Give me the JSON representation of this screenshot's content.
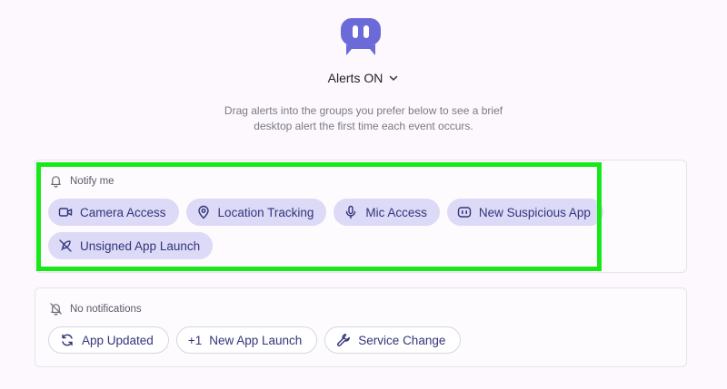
{
  "header": {
    "logo_icon": "robot-face-logo",
    "alerts_label": "Alerts ON",
    "description_line1": "Drag alerts into the groups you prefer below to see a brief",
    "description_line2": "desktop alert the first time each event occurs."
  },
  "groups": {
    "notify": {
      "title": "Notify me",
      "icon": "bell-icon",
      "chips": [
        {
          "label": "Camera Access",
          "icon": "video-camera-icon"
        },
        {
          "label": "Location Tracking",
          "icon": "map-pin-icon"
        },
        {
          "label": "Mic Access",
          "icon": "microphone-icon"
        },
        {
          "label": "New Suspicious App",
          "icon": "suspicious-app-icon"
        },
        {
          "label": "Unsigned App Launch",
          "icon": "rocket-off-icon"
        }
      ]
    },
    "none": {
      "title": "No notifications",
      "icon": "bell-off-icon",
      "chips": [
        {
          "label": "App Updated",
          "icon": "refresh-icon"
        },
        {
          "label": "New App Launch",
          "icon": "plus-one-icon",
          "prefix": "+1"
        },
        {
          "label": "Service Change",
          "icon": "wrench-icon"
        }
      ]
    }
  },
  "colors": {
    "accent": "#6b6ad8",
    "chip_fill": "#dcdaf6",
    "chip_text": "#33347a",
    "highlight": "#16e81a"
  }
}
